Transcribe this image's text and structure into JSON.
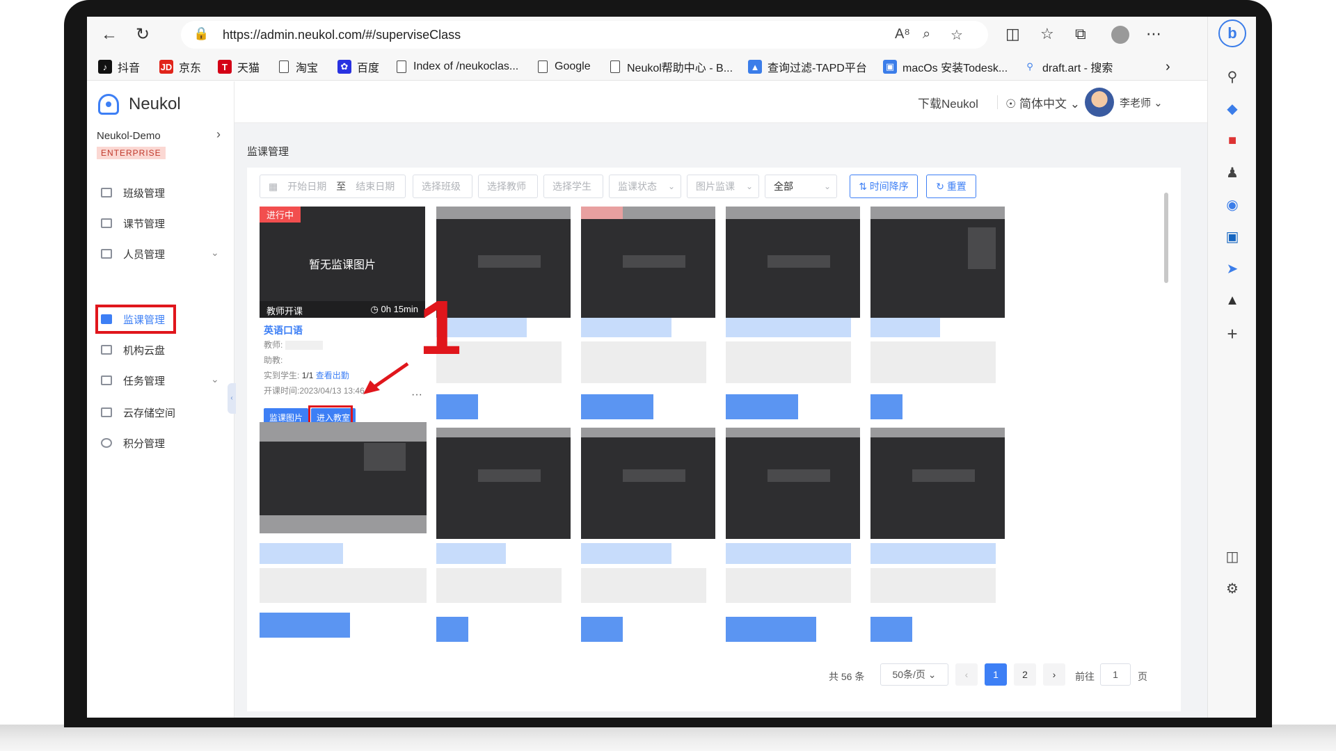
{
  "browser": {
    "url": "https://admin.neukol.com/#/superviseClass",
    "bookmarks": [
      {
        "label": "抖音"
      },
      {
        "label": "京东"
      },
      {
        "label": "天猫"
      },
      {
        "label": "淘宝"
      },
      {
        "label": "百度"
      },
      {
        "label": "Index of /neukoclas..."
      },
      {
        "label": "Google"
      },
      {
        "label": "Neukol帮助中心 - B..."
      },
      {
        "label": "查询过滤-TAPD平台"
      },
      {
        "label": "macOs 安装Todesk..."
      },
      {
        "label": "draft.art - 搜索"
      }
    ]
  },
  "app": {
    "logo_text": "Neukol",
    "org_name": "Neukol-Demo",
    "org_badge": "ENTERPRISE",
    "menu": [
      {
        "label": "班级管理"
      },
      {
        "label": "课节管理"
      },
      {
        "label": "人员管理"
      },
      {
        "label": "监课管理"
      },
      {
        "label": "机构云盘"
      },
      {
        "label": "任务管理"
      },
      {
        "label": "云存储空间"
      },
      {
        "label": "积分管理"
      }
    ],
    "header": {
      "download": "下载Neukol",
      "language": "简体中文",
      "user": "李老师"
    },
    "breadcrumb": "监课管理"
  },
  "filters": {
    "start_date": "开始日期",
    "to": "至",
    "end_date": "结束日期",
    "class": "选择班级",
    "teacher": "选择教师",
    "student": "选择学生",
    "status": "监课状态",
    "image": "图片监课",
    "all": "全部",
    "sort_btn": "时间降序",
    "reset_btn": "重置"
  },
  "card": {
    "tag": "进行中",
    "no_image": "暂无监课图片",
    "strip_left": "教师开课",
    "strip_right": "0h 15min",
    "title": "英语口语",
    "teacher_label": "教师:",
    "assistant_label": "助教:",
    "students_label": "实到学生:",
    "students_value": "1/1",
    "attendance_link": "查看出勤",
    "start_time": "开课时间:2023/04/13 13:46",
    "more": "···",
    "btn_images": "监课图片",
    "btn_enter": "进入教室"
  },
  "annotation": {
    "step": "1"
  },
  "pagination": {
    "total": "共 56 条",
    "page_size": "50条/页",
    "pages": [
      "1",
      "2"
    ],
    "goto_label": "前往",
    "goto_value": "1",
    "page_suffix": "页"
  }
}
